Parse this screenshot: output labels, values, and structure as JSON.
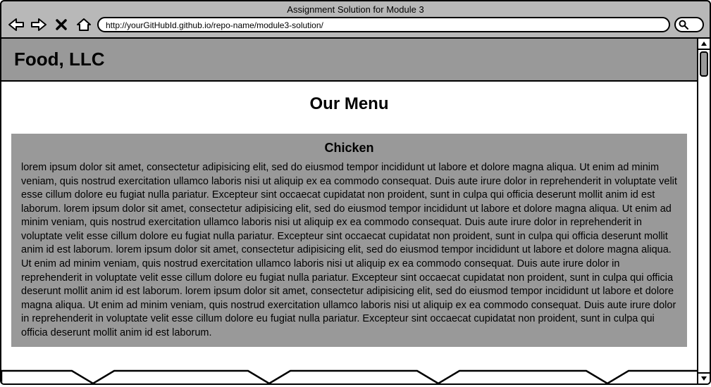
{
  "browser": {
    "title": "Assignment Solution for Module 3",
    "url": "http://yourGitHubId.github.io/repo-name/module3-solution/"
  },
  "header": {
    "brand": "Food, LLC"
  },
  "main": {
    "page_title": "Our Menu",
    "card": {
      "title": "Chicken",
      "body": "lorem ipsum dolor sit amet, consectetur adipisicing elit, sed do eiusmod tempor incididunt ut labore et dolore magna aliqua. Ut enim ad minim veniam, quis nostrud exercitation ullamco laboris nisi ut aliquip ex ea commodo consequat. Duis aute irure dolor in reprehenderit in voluptate velit esse cillum dolore eu fugiat nulla pariatur. Excepteur sint occaecat cupidatat non proident, sunt in culpa qui officia deserunt mollit anim id est laborum. lorem ipsum dolor sit amet, consectetur adipisicing elit, sed do eiusmod tempor incididunt ut labore et dolore magna aliqua. Ut enim ad minim veniam, quis nostrud exercitation ullamco laboris nisi ut aliquip ex ea commodo consequat. Duis aute irure dolor in reprehenderit in voluptate velit esse cillum dolore eu fugiat nulla pariatur. Excepteur sint occaecat cupidatat non proident, sunt in culpa qui officia deserunt mollit anim id est laborum. lorem ipsum dolor sit amet, consectetur adipisicing elit, sed do eiusmod tempor incididunt ut labore et dolore magna aliqua. Ut enim ad minim veniam, quis nostrud exercitation ullamco laboris nisi ut aliquip ex ea commodo consequat. Duis aute irure dolor in reprehenderit in voluptate velit esse cillum dolore eu fugiat nulla pariatur. Excepteur sint occaecat cupidatat non proident, sunt in culpa qui officia deserunt mollit anim id est laborum. lorem ipsum dolor sit amet, consectetur adipisicing elit, sed do eiusmod tempor incididunt ut labore et dolore magna aliqua. Ut enim ad minim veniam, quis nostrud exercitation ullamco laboris nisi ut aliquip ex ea commodo consequat. Duis aute irure dolor in reprehenderit in voluptate velit esse cillum dolore eu fugiat nulla pariatur. Excepteur sint occaecat cupidatat non proident, sunt in culpa qui officia deserunt mollit anim id est laborum."
    }
  }
}
